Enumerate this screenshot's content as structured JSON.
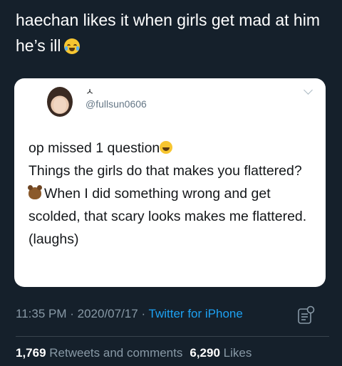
{
  "tweet": {
    "text": "haechan likes it when girls get mad at him he’s ill",
    "emoji_name": "loudly-crying-face-icon"
  },
  "quoted": {
    "name": "ㅅ",
    "handle": "@fullsun0606",
    "line1": "op missed 1 question",
    "line2": "Things the girls do that makes you flattered?",
    "line3": "When I did something wrong and get scolded, that scary looks makes me flattered. (laughs)"
  },
  "meta": {
    "time": "11:35 PM",
    "sep1": " · ",
    "date": "2020/07/17",
    "sep2": " · ",
    "source": "Twitter for iPhone"
  },
  "stats": {
    "retweets_count": "1,769",
    "retweets_label": "Retweets and comments",
    "likes_count": "6,290",
    "likes_label": "Likes"
  },
  "colors": {
    "background": "#15202b",
    "card": "#ffffff",
    "accent": "#1da1f2",
    "muted": "#8899a6"
  }
}
